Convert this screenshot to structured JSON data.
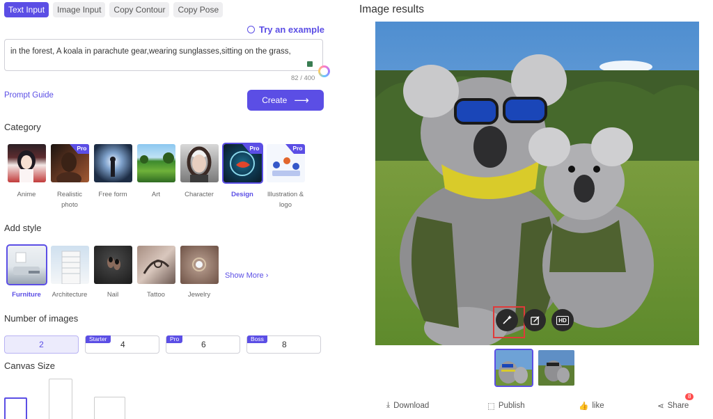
{
  "tabs": [
    {
      "label": "Text Input",
      "active": true
    },
    {
      "label": "Image Input",
      "active": false
    },
    {
      "label": "Copy Contour",
      "active": false
    },
    {
      "label": "Copy Pose",
      "active": false
    }
  ],
  "try_example": "Try an example",
  "prompt": {
    "value": "in the forest, A koala in parachute gear,wearing sunglasses,sitting on the grass,",
    "counter": "82 / 400"
  },
  "prompt_guide": "Prompt Guide",
  "create_label": "Create",
  "category": {
    "title": "Category",
    "items": [
      {
        "label": "Anime",
        "pro": false,
        "selected": false
      },
      {
        "label": "Realistic photo",
        "pro": true,
        "selected": false
      },
      {
        "label": "Free form",
        "pro": false,
        "selected": false
      },
      {
        "label": "Art",
        "pro": false,
        "selected": false
      },
      {
        "label": "Character",
        "pro": false,
        "selected": false
      },
      {
        "label": "Design",
        "pro": true,
        "selected": true
      },
      {
        "label": "Illustration & logo",
        "pro": true,
        "selected": false
      }
    ],
    "pro_label": "Pro"
  },
  "style": {
    "title": "Add style",
    "items": [
      {
        "label": "Furniture",
        "selected": true
      },
      {
        "label": "Architecture",
        "selected": false
      },
      {
        "label": "Nail",
        "selected": false
      },
      {
        "label": "Tattoo",
        "selected": false
      },
      {
        "label": "Jewelry",
        "selected": false
      }
    ],
    "show_more": "Show More"
  },
  "number_of_images": {
    "title": "Number of images",
    "options": [
      {
        "value": "2",
        "badge": "",
        "selected": true
      },
      {
        "value": "4",
        "badge": "Starter",
        "selected": false
      },
      {
        "value": "6",
        "badge": "Pro",
        "selected": false
      },
      {
        "value": "8",
        "badge": "Boss",
        "selected": false
      }
    ]
  },
  "canvas_size": {
    "title": "Canvas Size"
  },
  "results": {
    "title": "Image results",
    "actions": [
      "magic-wand-icon",
      "edit-icon",
      "hd-icon"
    ],
    "hd_label": "HD"
  },
  "bottom": {
    "download": "Download",
    "publish": "Publish",
    "like": "like",
    "share": "Share",
    "notification": "8"
  },
  "colors": {
    "accent": "#5b4ee5",
    "highlight": "#e03a3a"
  }
}
